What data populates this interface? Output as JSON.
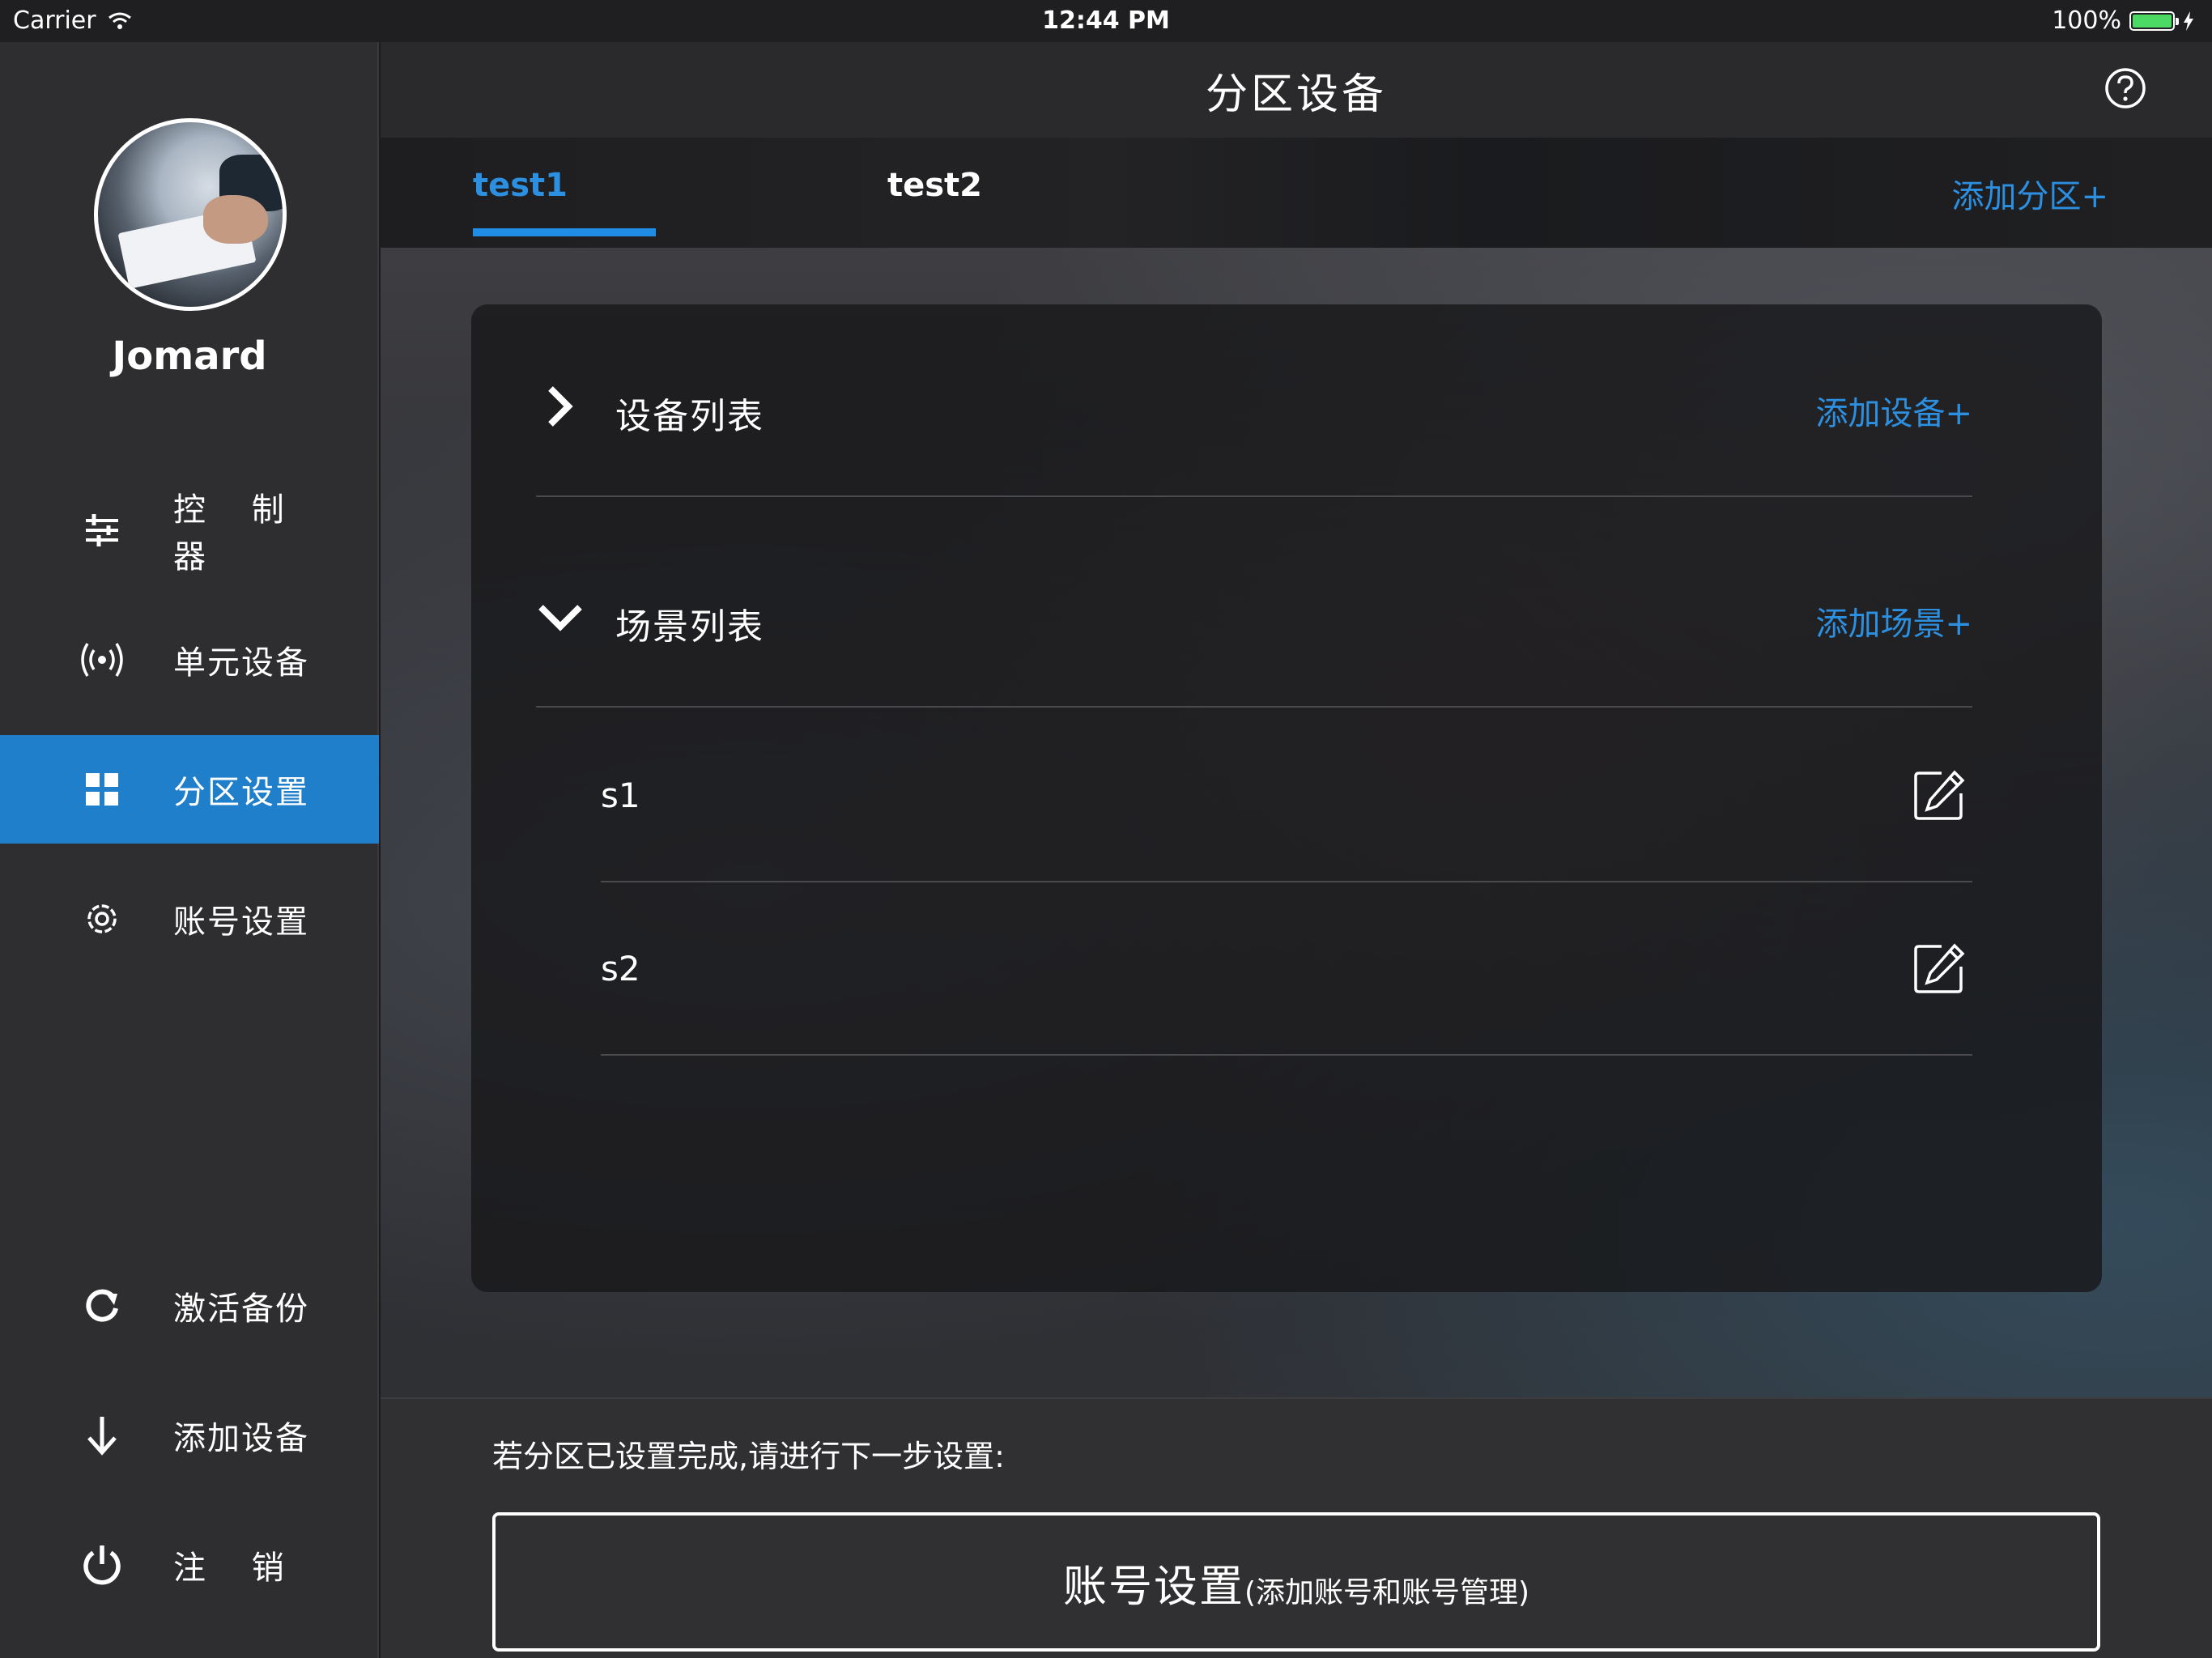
{
  "status_bar": {
    "carrier": "Carrier",
    "time": "12:44 PM",
    "battery": "100%",
    "battery_level": 1.0
  },
  "sidebar": {
    "username": "Jomard",
    "items": [
      {
        "label": "控 制 器",
        "icon": "sliders-icon"
      },
      {
        "label": "单元设备",
        "icon": "wireless-signal-icon"
      },
      {
        "label": "分区设置",
        "icon": "grid-icon",
        "active": true
      },
      {
        "label": "账号设置",
        "icon": "gear-icon"
      },
      {
        "label": "激活备份",
        "icon": "refresh-icon"
      },
      {
        "label": "添加设备",
        "icon": "arrow-down-icon"
      },
      {
        "label": "注 销",
        "icon": "power-icon"
      }
    ]
  },
  "navbar": {
    "title": "分区设备",
    "help_icon": "question-circle-icon"
  },
  "tabs": {
    "items": [
      "test1",
      "test2"
    ],
    "selected": "test1",
    "add_label": "添加分区+"
  },
  "card": {
    "device_section": {
      "title": "设备列表",
      "add_label": "添加设备+",
      "expanded": false
    },
    "scene_section": {
      "title": "场景列表",
      "add_label": "添加场景+",
      "expanded": true
    },
    "scenes": [
      "s1",
      "s2"
    ]
  },
  "footer": {
    "hint": "若分区已设置完成,请进行下一步设置:",
    "button_main": "账号设置",
    "button_sub": "(添加账号和账号管理)"
  },
  "colors": {
    "accent": "#1f7fcb",
    "link": "#2c8fe0",
    "sidebar_bg": "#2e2e30",
    "navbar_bg": "#2a2a2c"
  }
}
